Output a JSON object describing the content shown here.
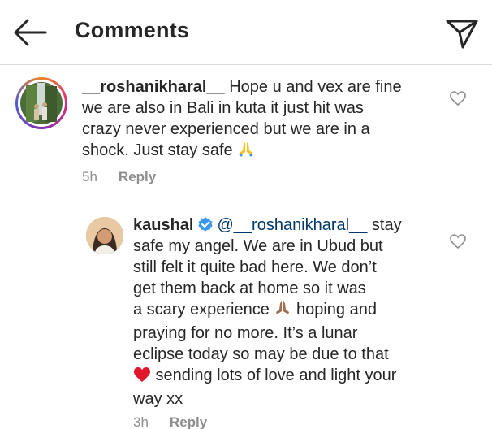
{
  "header": {
    "title": "Comments"
  },
  "comments": [
    {
      "username": "__roshanikharal__",
      "body_line1": " Hope u and vex are fine",
      "body_line2": "we are also in Bali in kuta it just hit was",
      "body_line3": "crazy never experienced but we are in a",
      "body_line4": "shock. Just stay safe",
      "emoji": "folded-hands",
      "time": "5h",
      "reply_label": "Reply"
    },
    {
      "username": "kaushal",
      "verified": true,
      "mention": "@__roshanikharal__",
      "body_line1_tail": " stay",
      "body_line2": "safe my angel. We are in Ubud but",
      "body_line3": "still felt it quite bad here. We don’t",
      "body_line4": "get them back at home so it was",
      "body_line5a": "a scary experience ",
      "body_line5b": " hoping and",
      "body_line6": "praying for no more. It’s a lunar",
      "body_line7": "eclipse today so may be due to that",
      "body_line8": " sending lots of love and light your",
      "body_line9": "way xx",
      "emojis": [
        "folded-hands-medium-skin",
        "red-heart"
      ],
      "time": "3h",
      "reply_label": "Reply"
    }
  ],
  "colors": {
    "text": "#262626",
    "muted": "#8e8e8e",
    "divider": "#dbdbdb",
    "mention": "#00376b",
    "verified": "#3897f0",
    "heart_emoji": "#e0162b"
  }
}
